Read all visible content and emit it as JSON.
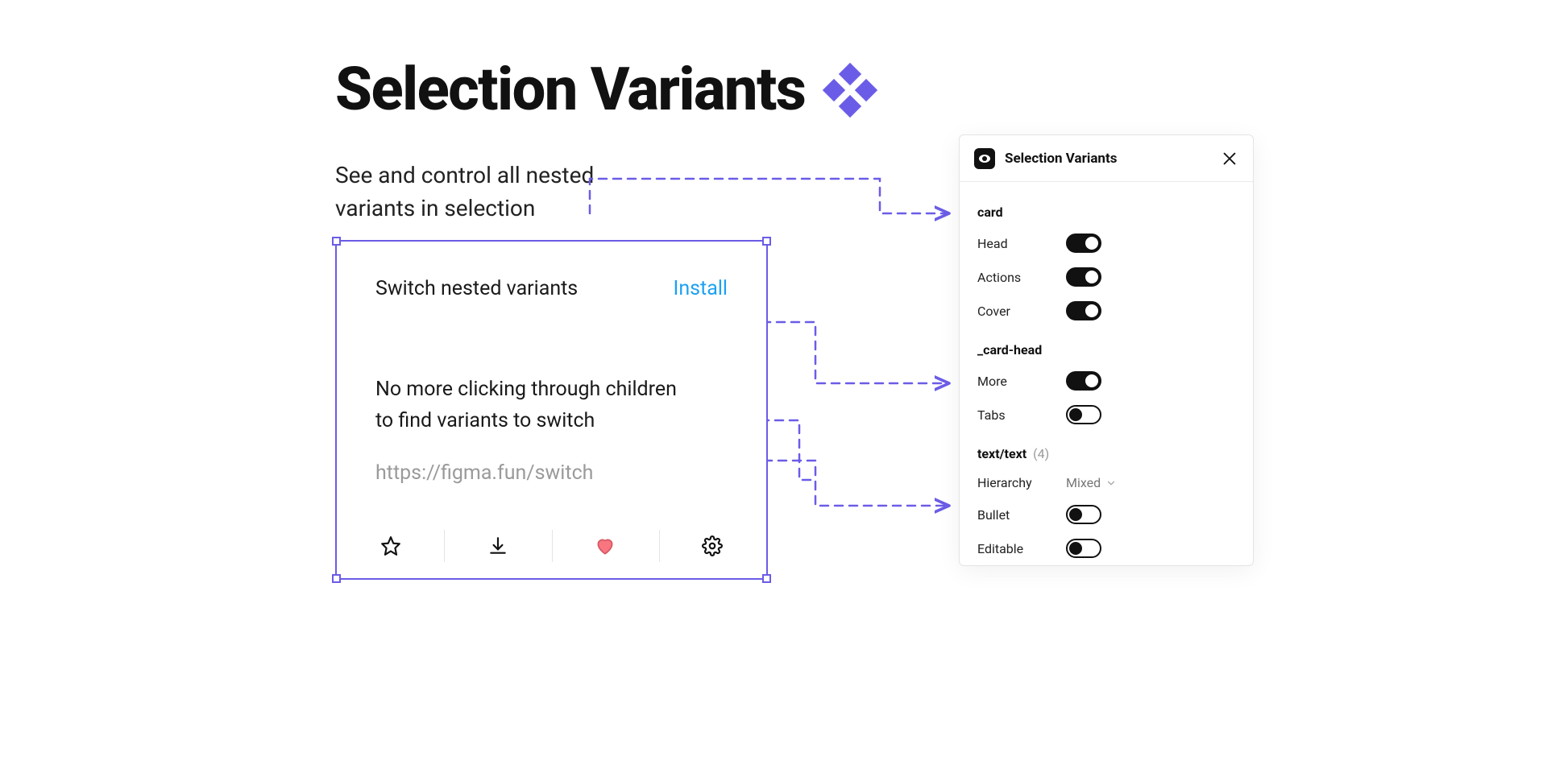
{
  "heading": "Selection Variants",
  "subhead": "See and control all nested variants in selection",
  "card": {
    "title": "Switch nested variants",
    "install": "Install",
    "body_line1": "No more clicking through children",
    "body_line2": "to find variants to switch",
    "url": "https://figma.fun/switch"
  },
  "panel": {
    "title": "Selection Variants",
    "groups": [
      {
        "name": "card",
        "props": [
          {
            "label": "Head",
            "type": "toggle",
            "on": true
          },
          {
            "label": "Actions",
            "type": "toggle",
            "on": true
          },
          {
            "label": "Cover",
            "type": "toggle",
            "on": true
          }
        ]
      },
      {
        "name": "_card-head",
        "props": [
          {
            "label": "More",
            "type": "toggle",
            "on": true
          },
          {
            "label": "Tabs",
            "type": "toggle",
            "on": false
          }
        ]
      },
      {
        "name": "text/text",
        "count": "(4)",
        "props": [
          {
            "label": "Hierarchy",
            "type": "select",
            "value": "Mixed"
          },
          {
            "label": "Bullet",
            "type": "toggle",
            "on": false
          },
          {
            "label": "Editable",
            "type": "toggle",
            "on": false
          }
        ]
      }
    ]
  },
  "icons": {
    "star": "star-icon",
    "download": "download-icon",
    "heart": "heart-icon",
    "gear": "gear-icon",
    "close": "close-icon",
    "chevron_down": "chevron-down-icon"
  },
  "colors": {
    "accent": "#6b5ce7",
    "link": "#1da1f2",
    "heart": "#f77680"
  }
}
